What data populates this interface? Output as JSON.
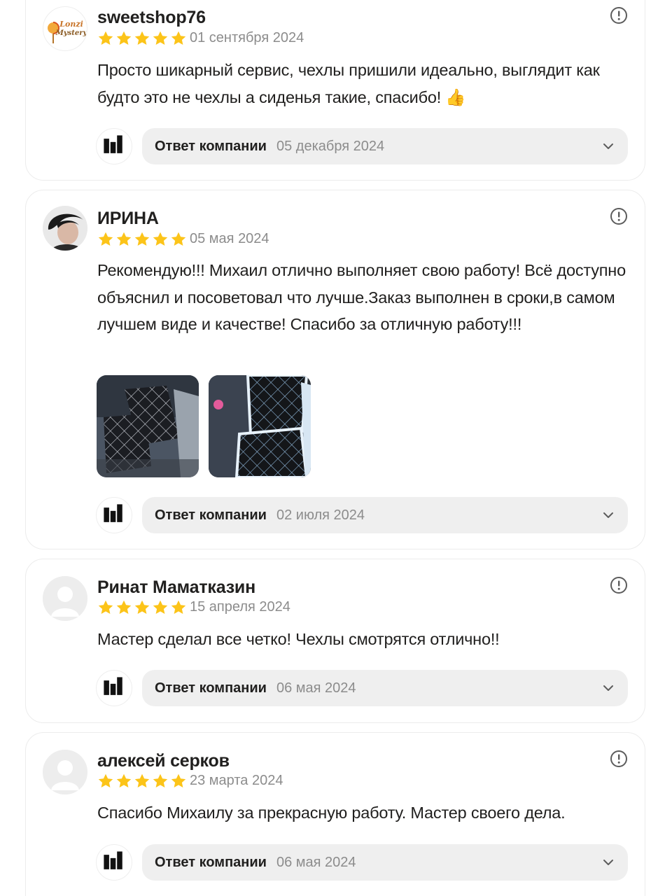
{
  "reviews": [
    {
      "author": "sweetshop76",
      "date": "01 сентября 2024",
      "rating": 5,
      "avatar_icon": "candy-shop-logo-icon",
      "avatar_text": [
        "Lonzi",
        "Mystery"
      ],
      "text": "Просто шикарный сервис, чехлы пришили идеально, выглядит как будто это не чехлы а сиденья такие, спасибо! 👍",
      "reply_label": "Ответ компании",
      "reply_date": "05 декабря 2024"
    },
    {
      "author": "ИРИНА",
      "date": "05 мая 2024",
      "rating": 5,
      "avatar_icon": "user-photo-icon",
      "text": "Рекомендую!!! Михаил отлично выполняет свою работу! Всё доступно объяснил и посоветовал что лучше.Заказ выполнен в сроки,в самом лучшем виде и качестве! Спасибо за отличную работу!!!",
      "photos": [
        "car-seat-cover-photo",
        "car-seat-cover-photo"
      ],
      "reply_label": "Ответ компании",
      "reply_date": "02 июля 2024"
    },
    {
      "author": "Ринат Маматказин",
      "date": "15 апреля 2024",
      "rating": 5,
      "avatar_icon": "default-user-icon",
      "text": "Мастер сделал все четко! Чехлы смотрятся отлично!!",
      "reply_label": "Ответ компании",
      "reply_date": "06 мая 2024"
    },
    {
      "author": "алексей серков",
      "date": "23 марта 2024",
      "rating": 5,
      "avatar_icon": "default-user-icon",
      "text": "Спасибо Михаилу за прекрасную работу. Мастер своего дела.",
      "reply_label": "Ответ компании",
      "reply_date": "06 мая 2024"
    }
  ],
  "icons": {
    "star": "star-icon",
    "info": "info-icon",
    "chevron": "chevron-down-icon",
    "company": "company-logo-icon"
  },
  "colors": {
    "star": "#fcc419",
    "muted_text": "#8c8c8c",
    "reply_bg": "#efefef",
    "card_border": "#ececec"
  }
}
